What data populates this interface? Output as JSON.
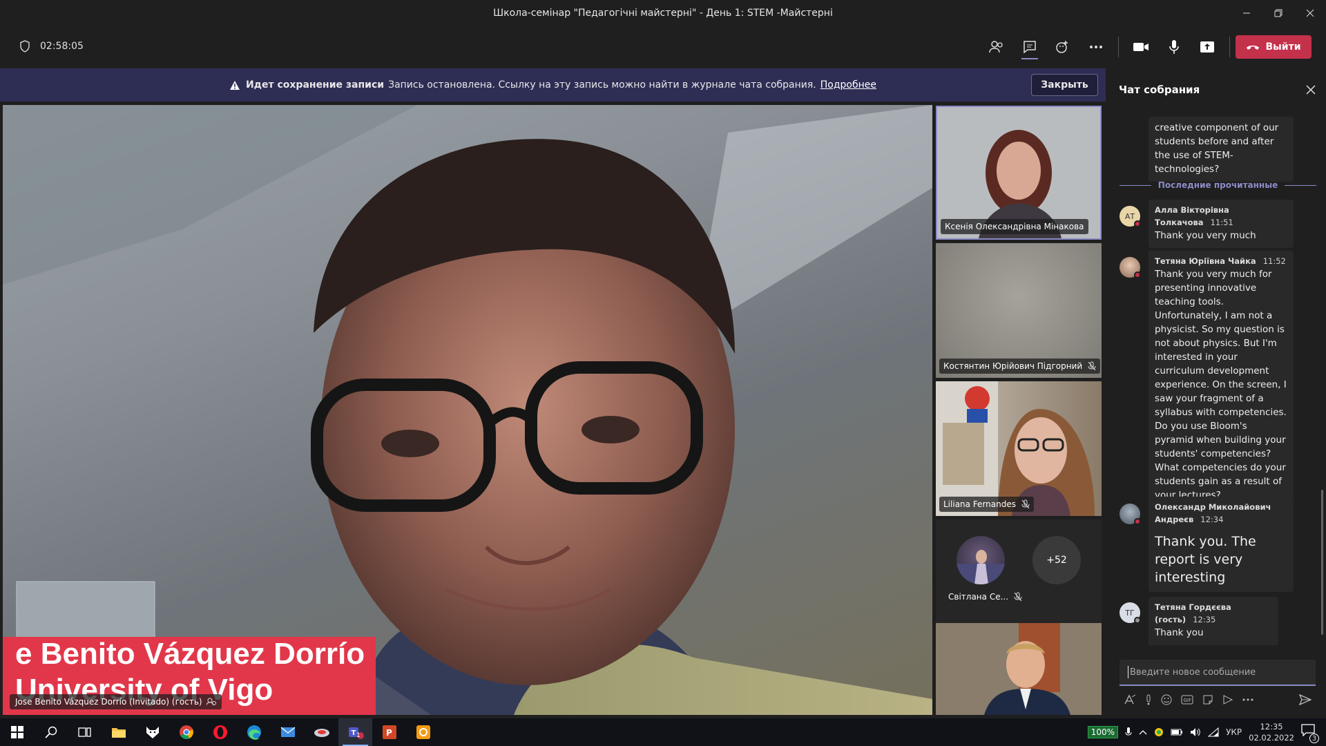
{
  "window": {
    "title": "Школа-семінар \"Педагогічні майстерні\" - День 1: STEM -Майстерні"
  },
  "toolbar": {
    "timer": "02:58:05",
    "leave_label": "Выйти"
  },
  "banner": {
    "bold": "Идет сохранение записи",
    "text": "Запись остановлена. Ссылку на эту запись можно найти в журнале чата собрания.",
    "link": "Подробнее",
    "close_label": "Закрыть"
  },
  "main_video": {
    "lower_third_line1": "e Benito Vázquez Dorrío",
    "lower_third_line2": "University of Vigo",
    "label": "Jose Benito Vázquez Dorrío (Invitado) (гость)"
  },
  "tiles": [
    {
      "name": "Ксенія Олександрівна Мінакова"
    },
    {
      "name": "Костянтин Юрійович Підгорний"
    },
    {
      "name": "Liliana Fernandes"
    }
  ],
  "overflow": {
    "small_name": "Світлана Се...",
    "more_count": "+52"
  },
  "chat": {
    "title": "Чат собрания",
    "prev_message": "creative component of our students before and after the use of STEM-technologies?",
    "last_read": "Последние прочитанные",
    "messages": [
      {
        "initials": "АТ",
        "author": "Алла Вікторівна Толкачова",
        "time": "11:51",
        "text": "Thank you very much"
      },
      {
        "initials": "",
        "author": "Тетяна Юріївна Чайка",
        "time": "11:52",
        "text": "Thank you very much for presenting innovative teaching tools.",
        "text2": "Unfortunately, I am not a physicist. So my question is not about physics. But I'm interested in your curriculum development experience. On the screen, I saw your fragment of a syllabus with competencies. Do you use Bloom's pyramid when building your students' competencies? What competencies do your students gain as a result of your lectures?"
      },
      {
        "initials": "",
        "author": "Олександр Миколайович Андреєв",
        "time": "12:34",
        "text": "Thank you. The report is very interesting"
      },
      {
        "initials": "ТГ",
        "author": "Тетяна Гордєєва (гость)",
        "time": "12:35",
        "text": "Thank you"
      }
    ],
    "compose_placeholder": "Введите новое сообщение"
  },
  "taskbar": {
    "zoom": "100%",
    "lang": "УКР",
    "time": "12:35",
    "date": "02.02.2022",
    "notif_count": "3",
    "teams_badge": "1"
  },
  "colors": {
    "accent": "#8b8cc7",
    "leave": "#c4314b",
    "banner": "#2e2d54",
    "lower_third": "#e2374a"
  }
}
